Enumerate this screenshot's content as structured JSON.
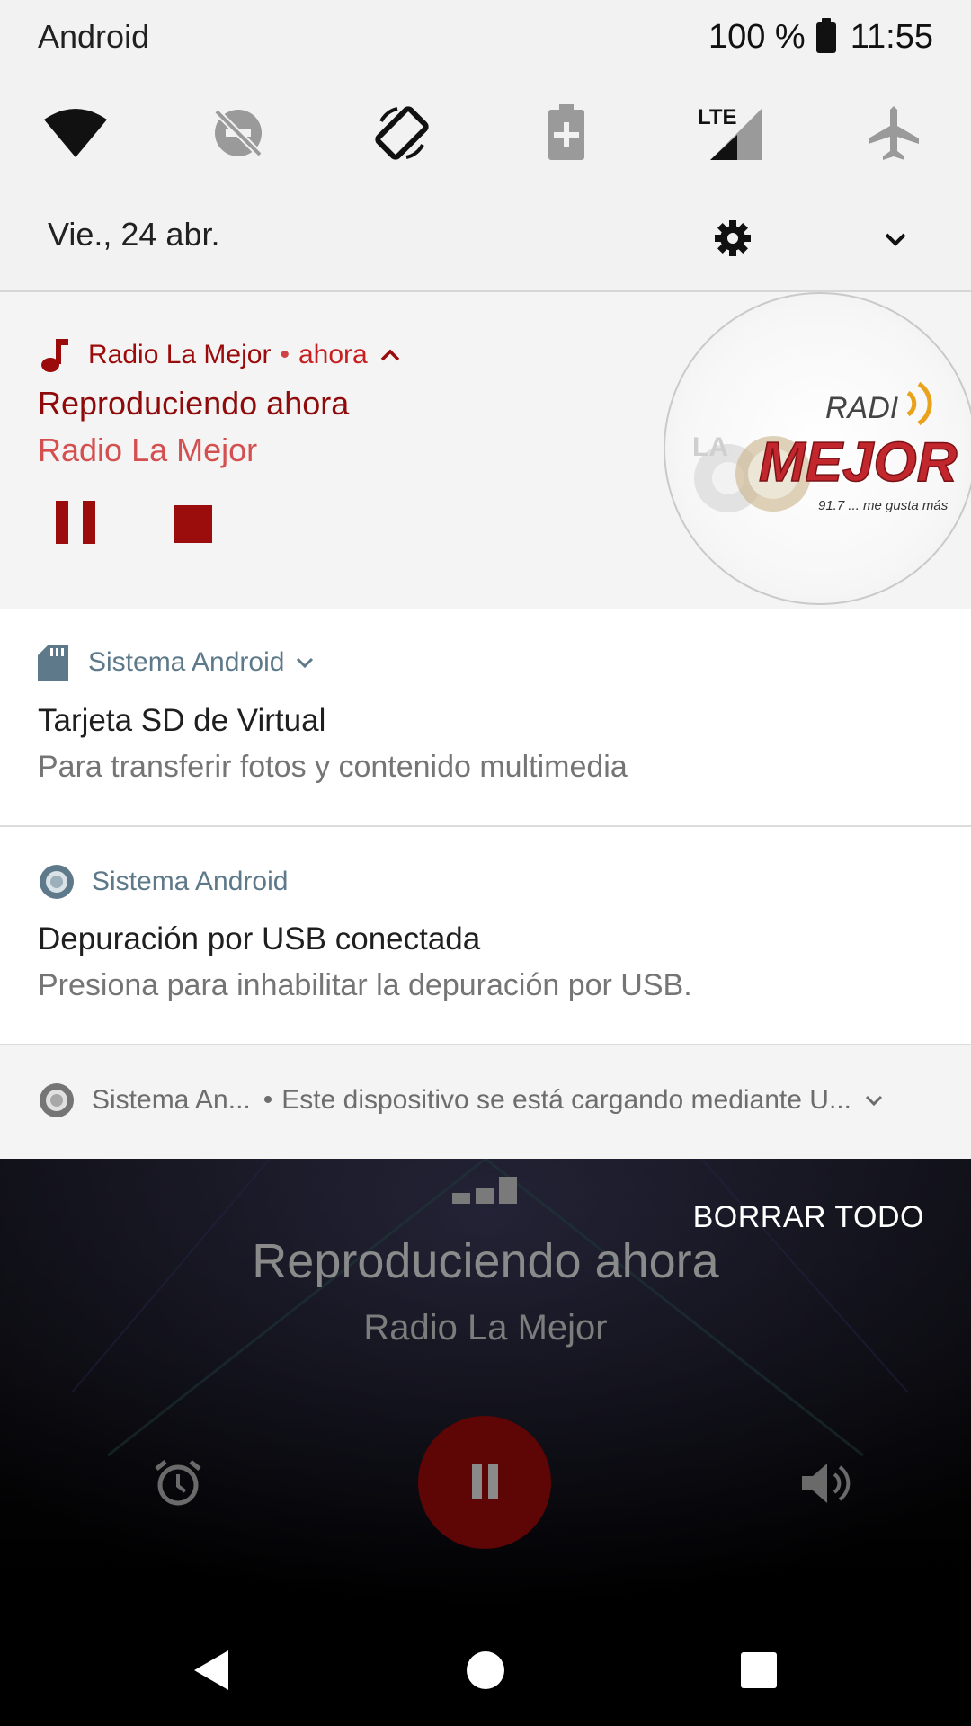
{
  "status_bar": {
    "carrier": "Android",
    "battery_percent": "100 %",
    "time": "11:55"
  },
  "quick_settings": {
    "tiles": [
      "wifi-icon",
      "do-not-disturb-off-icon",
      "auto-rotate-icon",
      "battery-saver-icon",
      "lte-signal-icon",
      "airplane-mode-icon"
    ],
    "lte_label": "LTE",
    "date": "Vie., 24 abr."
  },
  "media_notification": {
    "app_name": "Radio La Mejor",
    "separator": "•",
    "time": "ahora",
    "title": "Reproduciendo ahora",
    "subtitle": "Radio La Mejor",
    "artwork": {
      "word_radio": "RADI",
      "word_la": "LA",
      "word_mejor": "MEJOR",
      "tagline": "91.7 ... me gusta más"
    }
  },
  "notifications": [
    {
      "app": "Sistema Android",
      "title": "Tarjeta SD de Virtual",
      "text": "Para transferir fotos y contenido multimedia"
    },
    {
      "app": "Sistema Android",
      "title": "Depuración por USB conectada",
      "text": "Presiona para inhabilitar la depuración por USB."
    }
  ],
  "collapsed_notification": {
    "app": "Sistema An...",
    "separator": "•",
    "text": "Este dispositivo se está cargando mediante U..."
  },
  "clear_all": "BORRAR TODO",
  "app": {
    "title": "Reproduciendo ahora",
    "subtitle": "Radio La Mejor"
  },
  "colors": {
    "accent": "#9b0d0d",
    "system_header": "#5e7a8a"
  }
}
